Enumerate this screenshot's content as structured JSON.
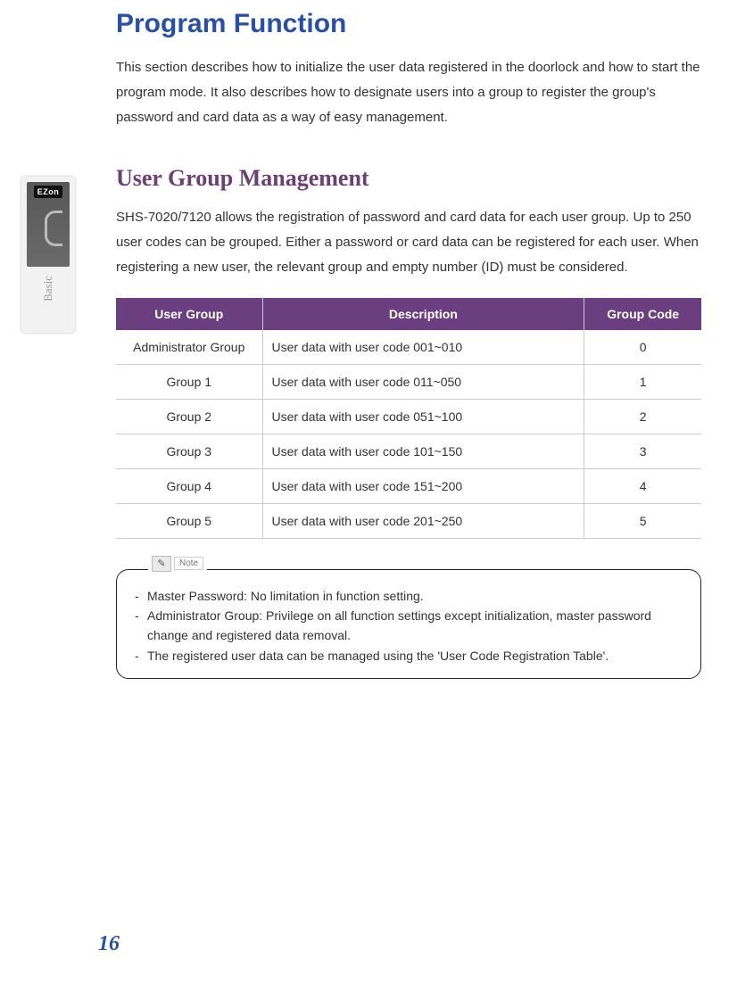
{
  "page": {
    "title": "Program Function",
    "intro": "This section describes how to initialize the user data registered in the doorlock and how to start the program mode. It also describes how to designate users into a group to register the group's password and card data as a way of easy management.",
    "number": "16"
  },
  "sidebar": {
    "brand": "EZon",
    "vertical_label": "Basic"
  },
  "section": {
    "heading": "User Group Management",
    "text": "SHS-7020/7120 allows the registration of password and card data for each user group. Up to 250 user codes can be grouped. Either a password or card data can be registered for each user. When registering a new user, the relevant group and empty number (ID) must be considered."
  },
  "table": {
    "headers": {
      "c1": "User Group",
      "c2": "Description",
      "c3": "Group Code"
    },
    "rows": [
      {
        "group": "Administrator Group",
        "desc": "User data with user code 001~010",
        "code": "0"
      },
      {
        "group": "Group 1",
        "desc": "User data with user code 011~050",
        "code": "1"
      },
      {
        "group": "Group 2",
        "desc": "User data with user code 051~100",
        "code": "2"
      },
      {
        "group": "Group 3",
        "desc": "User data with user code 101~150",
        "code": "3"
      },
      {
        "group": "Group 4",
        "desc": "User data with user code 151~200",
        "code": "4"
      },
      {
        "group": "Group 5",
        "desc": "User data with user code 201~250",
        "code": "5"
      }
    ]
  },
  "note": {
    "label": "Note",
    "lines": [
      "Master Password: No limitation in function setting.",
      "Administrator Group: Privilege on all function settings except initialization, master password change and registered data removal.",
      "The registered user data can be managed using the 'User Code Registration Table'."
    ]
  }
}
